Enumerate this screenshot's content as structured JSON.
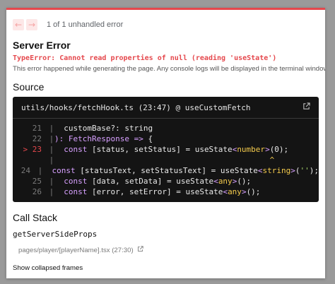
{
  "nav": {
    "prev_glyph": "←",
    "next_glyph": "→",
    "counter": "1 of 1 unhandled error"
  },
  "error": {
    "heading": "Server Error",
    "message": "TypeError: Cannot read properties of null (reading 'useState')",
    "hint": "This error happened while generating the page. Any console logs will be displayed in the terminal window."
  },
  "source": {
    "heading": "Source",
    "file": "utils/hooks/fetchHook.ts (23:47) @ useCustomFetch",
    "open_icon": "external-link-icon",
    "lines": [
      {
        "no": "21",
        "active": false,
        "pointer": " ",
        "html_key": "l21"
      },
      {
        "no": "22",
        "active": false,
        "pointer": " ",
        "html_key": "l22"
      },
      {
        "no": "23",
        "active": true,
        "pointer": ">",
        "html_key": "l23"
      },
      {
        "no": "",
        "active": false,
        "pointer": " ",
        "html_key": "marker"
      },
      {
        "no": "24",
        "active": false,
        "pointer": " ",
        "html_key": "l24"
      },
      {
        "no": "25",
        "active": false,
        "pointer": " ",
        "html_key": "l25"
      },
      {
        "no": "26",
        "active": false,
        "pointer": " ",
        "html_key": "l26"
      }
    ],
    "code": {
      "l21": "  customBase?: string",
      "l22": "): FetchResponse => {",
      "l23": "  const [status, setStatus] = useState<number>(0);",
      "marker": "                                              ^",
      "l24": "  const [statusText, setStatusText] = useState<string>('');",
      "l25": "  const [data, setData] = useState<any>();",
      "l26": "  const [error, setError] = useState<any>();"
    }
  },
  "callstack": {
    "heading": "Call Stack",
    "function": "getServerSideProps",
    "file": "pages/player/[playerName].tsx (27:30)",
    "open_icon": "external-link-icon",
    "collapsed_label": "Show collapsed frames"
  },
  "colors": {
    "accent": "#e5484d",
    "code_bg": "#141414"
  }
}
